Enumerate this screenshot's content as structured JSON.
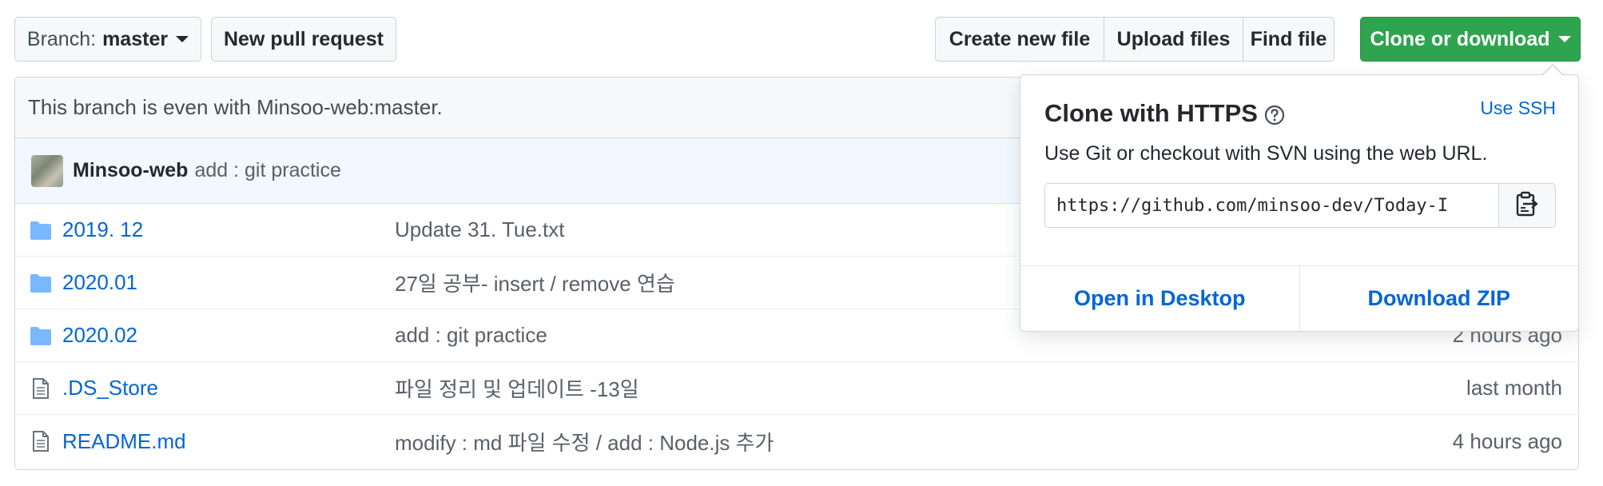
{
  "toolbar": {
    "branch_prefix": "Branch:",
    "branch_name": "master",
    "new_pull_request": "New pull request",
    "create_new_file": "Create new file",
    "upload_files": "Upload files",
    "find_file": "Find file",
    "clone_or_download": "Clone or download"
  },
  "branch_status": "This branch is even with Minsoo-web:master.",
  "latest_commit": {
    "author": "Minsoo-web",
    "message": "add : git practice"
  },
  "files": [
    {
      "type": "folder",
      "name": "2019. 12",
      "message": "Update 31. Tue.txt",
      "age": ""
    },
    {
      "type": "folder",
      "name": "2020.01",
      "message": "27일 공부- insert / remove 연습",
      "age": ""
    },
    {
      "type": "folder",
      "name": "2020.02",
      "message": "add : git practice",
      "age": "2 hours ago"
    },
    {
      "type": "file",
      "name": ".DS_Store",
      "message": "파일 정리 및 업데이트 -13일",
      "age": "last month"
    },
    {
      "type": "file",
      "name": "README.md",
      "message": "modify : md 파일 수정 / add : Node.js 추가",
      "age": "4 hours ago"
    }
  ],
  "clone_dropdown": {
    "title": "Clone with HTTPS",
    "use_ssh": "Use SSH",
    "description": "Use Git or checkout with SVN using the web URL.",
    "url": "https://github.com/minsoo-dev/Today-I",
    "open_in_desktop": "Open in Desktop",
    "download_zip": "Download ZIP"
  },
  "colors": {
    "primary_green": "#2ea44f",
    "link_blue": "#0366d6",
    "folder_icon": "#79b8ff"
  },
  "icons": {
    "folder": "folder-icon",
    "file": "file-icon",
    "help": "question-circle-icon",
    "clipboard": "clipboard-icon",
    "caret": "caret-down-icon"
  }
}
